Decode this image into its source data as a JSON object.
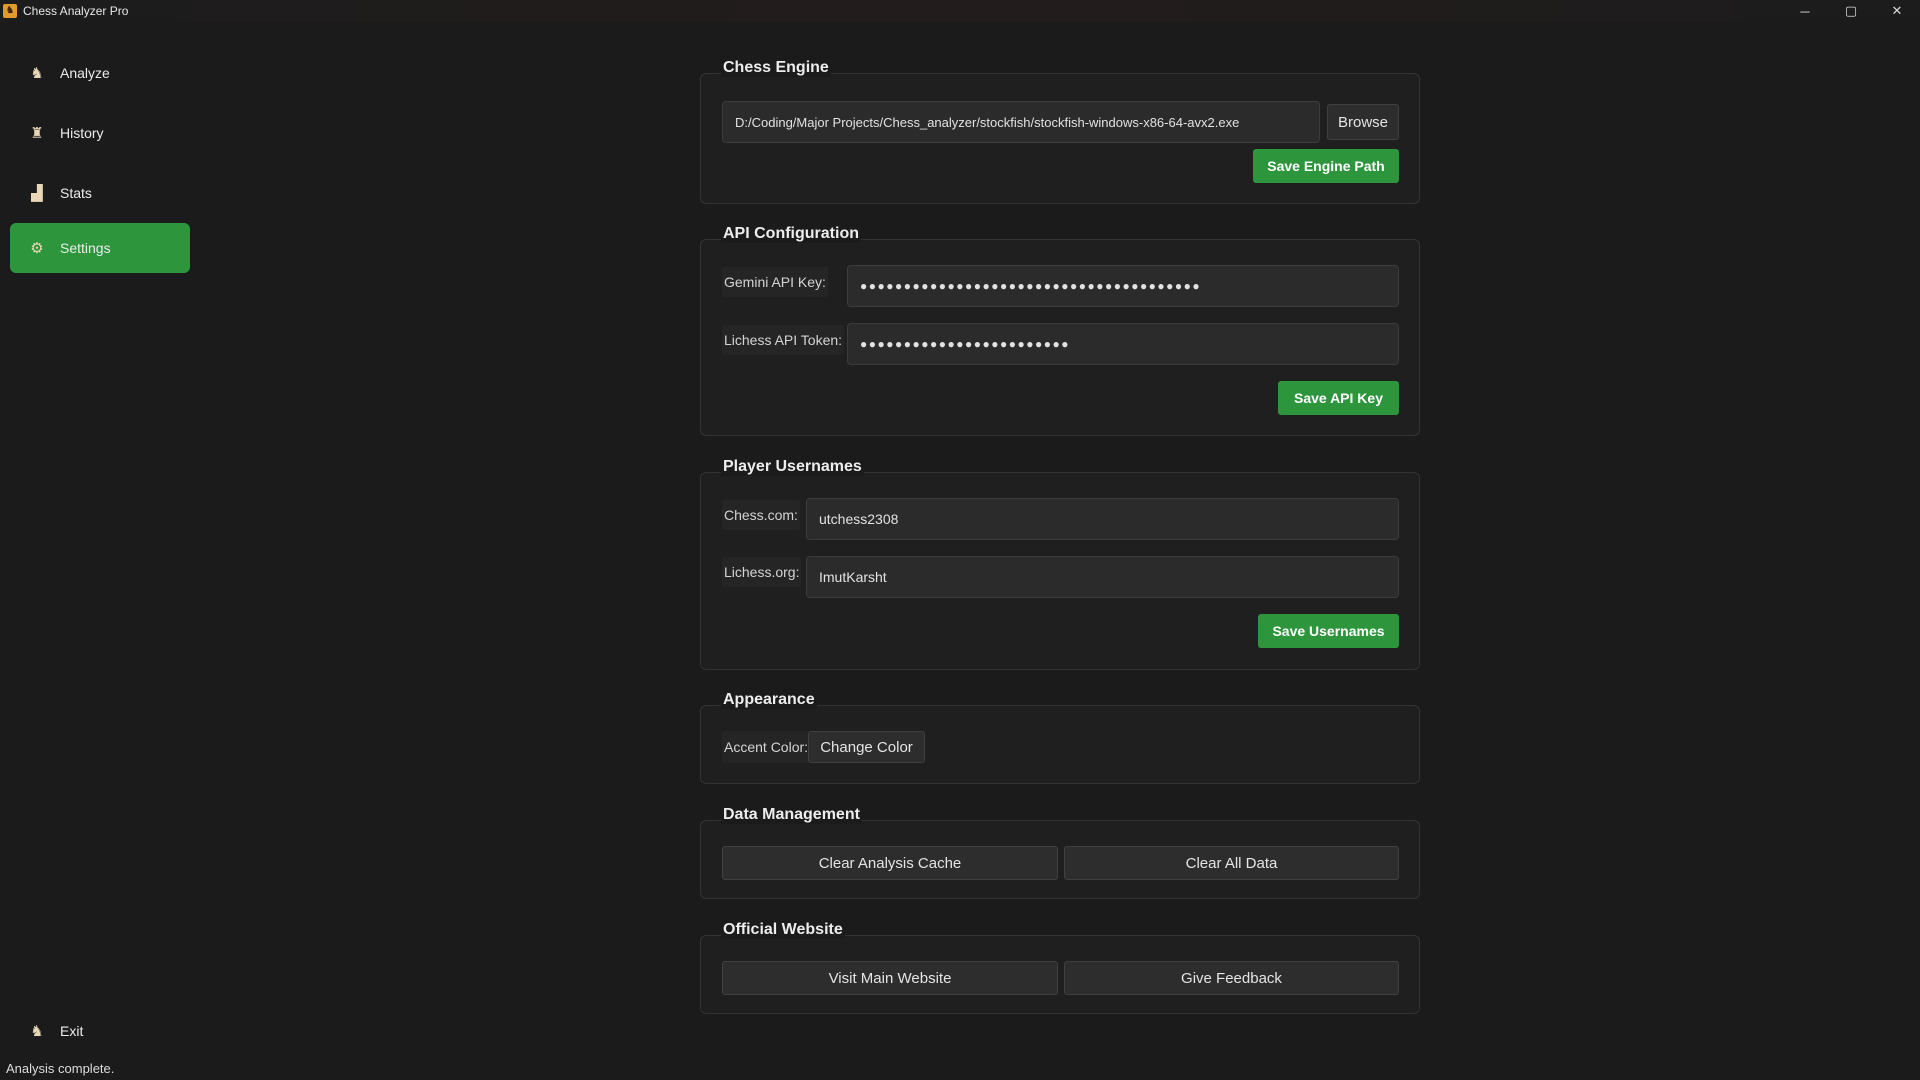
{
  "window": {
    "title": "Chess Analyzer Pro",
    "icon": "chess-app-icon",
    "controls": {
      "minimize": "─",
      "maximize": "▢",
      "close": "✕"
    }
  },
  "sidebar": {
    "items": [
      {
        "label": "Analyze",
        "icon": "analyze-icon",
        "glyph": "♞",
        "active": false
      },
      {
        "label": "History",
        "icon": "history-icon",
        "glyph": "♜",
        "active": false
      },
      {
        "label": "Stats",
        "icon": "stats-icon",
        "glyph": "▟",
        "active": false
      },
      {
        "label": "Settings",
        "icon": "settings-icon",
        "glyph": "⚙",
        "active": true
      }
    ],
    "exit": {
      "label": "Exit",
      "icon": "exit-icon",
      "glyph": "♞"
    }
  },
  "status": "Analysis complete.",
  "engine": {
    "title": "Chess Engine",
    "path": "D:/Coding/Major Projects/Chess_analyzer/stockfish/stockfish-windows-x86-64-avx2.exe",
    "browse_label": "Browse",
    "save_label": "Save Engine Path"
  },
  "api": {
    "title": "API Configuration",
    "gemini_label": "Gemini API Key:",
    "gemini_value": "●●●●●●●●●●●●●●●●●●●●●●●●●●●●●●●●●●●●●●●",
    "lichess_label": "Lichess API Token:",
    "lichess_value": "●●●●●●●●●●●●●●●●●●●●●●●●",
    "save_label": "Save API Key"
  },
  "players": {
    "title": "Player Usernames",
    "chesscom_label": "Chess.com:",
    "chesscom_value": "utchess2308",
    "lichess_label": "Lichess.org:",
    "lichess_value": "ImutKarsht",
    "save_label": "Save Usernames"
  },
  "appearance": {
    "title": "Appearance",
    "accent_label": "Accent Color:",
    "change_label": "Change Color"
  },
  "data_mgmt": {
    "title": "Data Management",
    "clear_cache_label": "Clear Analysis Cache",
    "clear_all_label": "Clear All Data"
  },
  "website": {
    "title": "Official Website",
    "visit_label": "Visit Main Website",
    "feedback_label": "Give Feedback"
  },
  "colors": {
    "accent": "#2d963c",
    "background": "#1b1b1b"
  }
}
